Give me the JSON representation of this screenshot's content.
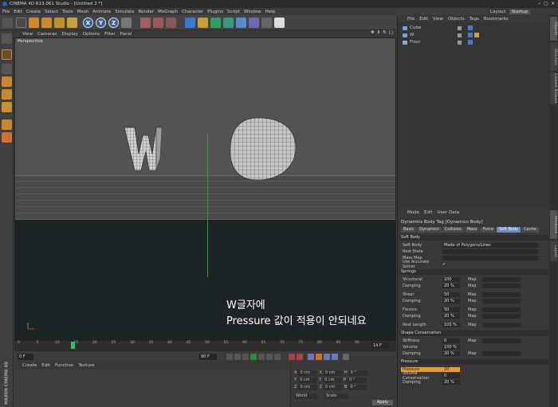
{
  "app": {
    "title": "CINEMA 4D R13.061 Studio - [Untitled 2 *]"
  },
  "menubar": [
    "File",
    "Edit",
    "Create",
    "Select",
    "Tools",
    "Mesh",
    "Animate",
    "Simulate",
    "Render",
    "MoGraph",
    "Character",
    "Plugins",
    "Script",
    "Window",
    "Help"
  ],
  "layout": {
    "label": "Layout:",
    "value": "Startup"
  },
  "toolbar_axes": [
    "X",
    "Y",
    "Z"
  ],
  "viewport": {
    "menu": [
      "View",
      "Cameras",
      "Display",
      "Options",
      "Filter",
      "Panel"
    ],
    "label": "Perspective",
    "caption_line1": "W글자에",
    "caption_line2": "Pressure 값이 적용이 안되네요"
  },
  "timeline": {
    "ticks": [
      "0",
      "5",
      "10",
      "15",
      "20",
      "25",
      "30",
      "35",
      "40",
      "45",
      "50",
      "55",
      "60",
      "65",
      "70",
      "75",
      "80",
      "85",
      "90"
    ],
    "current_frame": "14 F",
    "start": "0 F",
    "end": "90 F",
    "start_field": "0 F"
  },
  "material": {
    "menu": [
      "Create",
      "Edit",
      "Function",
      "Texture"
    ]
  },
  "coords": {
    "rows": [
      {
        "a": "X",
        "av": "0 cm",
        "b": "X",
        "bv": "0 cm",
        "c": "H",
        "cv": "0 °"
      },
      {
        "a": "Y",
        "av": "0 cm",
        "b": "Y",
        "bv": "0 cm",
        "c": "P",
        "cv": "0 °"
      },
      {
        "a": "Z",
        "av": "0 cm",
        "b": "Z",
        "bv": "0 cm",
        "c": "B",
        "cv": "0 °"
      }
    ],
    "mode1": "World",
    "mode2": "Scale",
    "apply": "Apply"
  },
  "objects": {
    "menu": [
      "File",
      "Edit",
      "View",
      "Objects",
      "Tags",
      "Bookmarks"
    ],
    "items": [
      {
        "name": "Cube",
        "color": "#6fa0d8"
      },
      {
        "name": "W",
        "color": "#6fa0d8"
      },
      {
        "name": "Floor",
        "color": "#8aa8d8"
      }
    ]
  },
  "attributes": {
    "menu": [
      "Mode",
      "Edit",
      "User Data"
    ],
    "title": "Dynamics Body Tag [Dynamics Body]",
    "tabs": [
      "Basic",
      "Dynamics",
      "Collision",
      "Mass",
      "Force",
      "Soft Body",
      "Cache"
    ],
    "active_tab": "Soft Body",
    "section_softbody": "Soft Body",
    "soft_body_label": "Soft Body",
    "soft_body_value": "Made of Polygons/Lines",
    "rest_state": "Rest State",
    "mass_map": "Mass Map",
    "use_solver": "Use Accurate Solver",
    "use_solver_val": "✔",
    "section_springs": "Springs",
    "springs": [
      {
        "label": "Structural",
        "value": "100"
      },
      {
        "label": "Damping",
        "value": "20 %"
      },
      {
        "label": "Shear",
        "value": "50"
      },
      {
        "label": "Damping",
        "value": "20 %"
      },
      {
        "label": "Flexion",
        "value": "50"
      },
      {
        "label": "Damping",
        "value": "20 %"
      },
      {
        "label": "Rest Length",
        "value": "100 %"
      }
    ],
    "map_label": "Map",
    "section_shape": "Shape Conservation",
    "shape": [
      {
        "label": "Stiffness",
        "value": "0"
      },
      {
        "label": "Volume",
        "value": "100 %"
      },
      {
        "label": "Damping",
        "value": "20 %"
      }
    ],
    "section_pressure": "Pressure",
    "pressure": [
      {
        "label": "Pressure",
        "value": "20"
      },
      {
        "label": "Volume Conservation",
        "value": "0"
      },
      {
        "label": "Damping",
        "value": "20 %"
      }
    ]
  },
  "side_tabs": [
    "Objects",
    "Structure",
    "Content Browser",
    "Attributes",
    "Layers"
  ],
  "logo": "MAXON CINEMA 4D"
}
